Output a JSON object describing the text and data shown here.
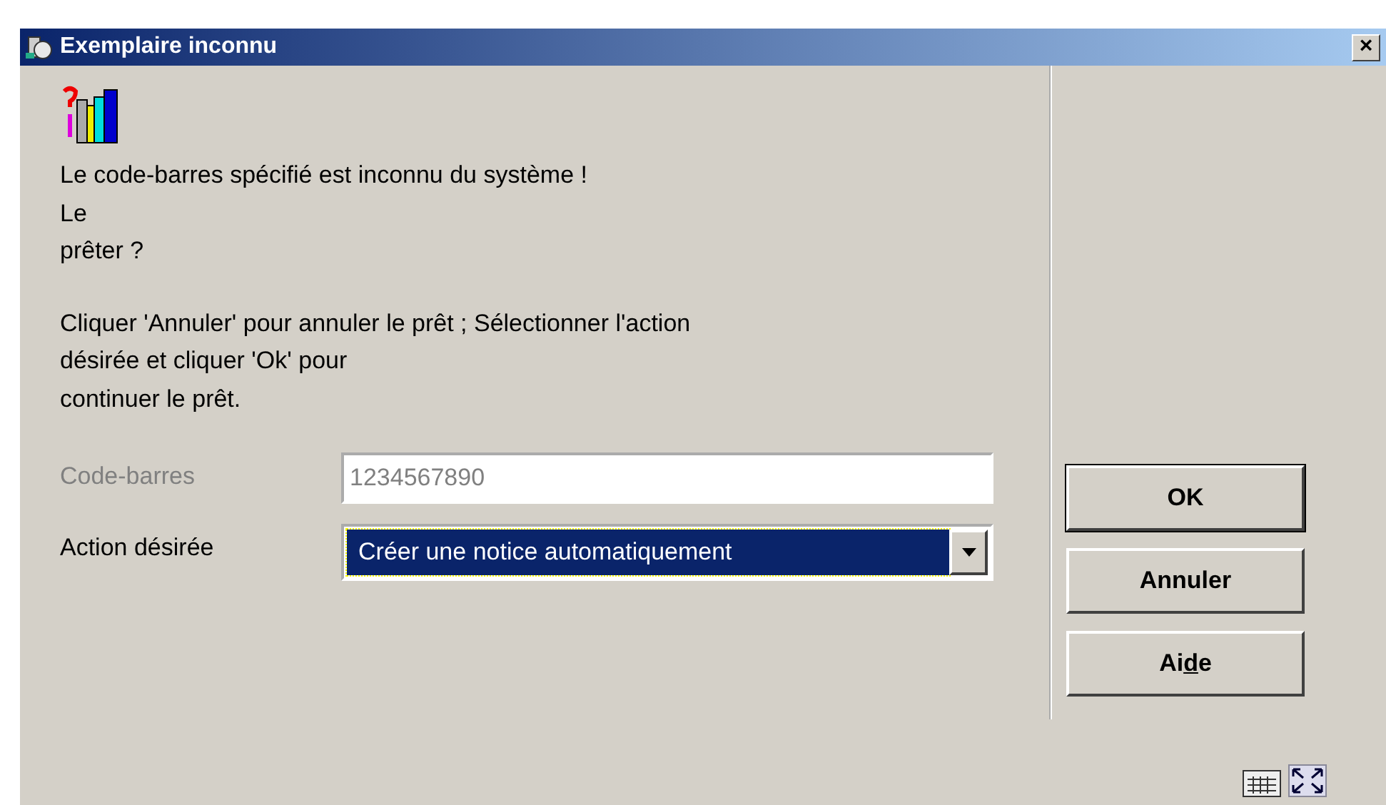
{
  "window": {
    "title": "Exemplaire inconnu",
    "close": "×"
  },
  "message": {
    "lines": [
      "Le code-barres spécifié est inconnu du système !",
      "Le",
      "prêter ?"
    ]
  },
  "instruction": {
    "lines": [
      "Cliquer 'Annuler' pour annuler le prêt ; Sélectionner l'action",
      "désirée et cliquer 'Ok' pour",
      "continuer le prêt."
    ]
  },
  "fields": [
    {
      "kind": "text",
      "label": "Code-barres",
      "disabled": true,
      "value": "1234567890"
    },
    {
      "kind": "select",
      "label": "Action désirée",
      "disabled": false,
      "value": "Créer une notice automatiquement",
      "selected": true
    }
  ],
  "buttons": [
    {
      "label": "OK",
      "default": true
    },
    {
      "label": "Annuler",
      "default": false
    },
    {
      "label": "Ai",
      "mnemonic": "d",
      "label_rest": "e",
      "default": false
    }
  ]
}
